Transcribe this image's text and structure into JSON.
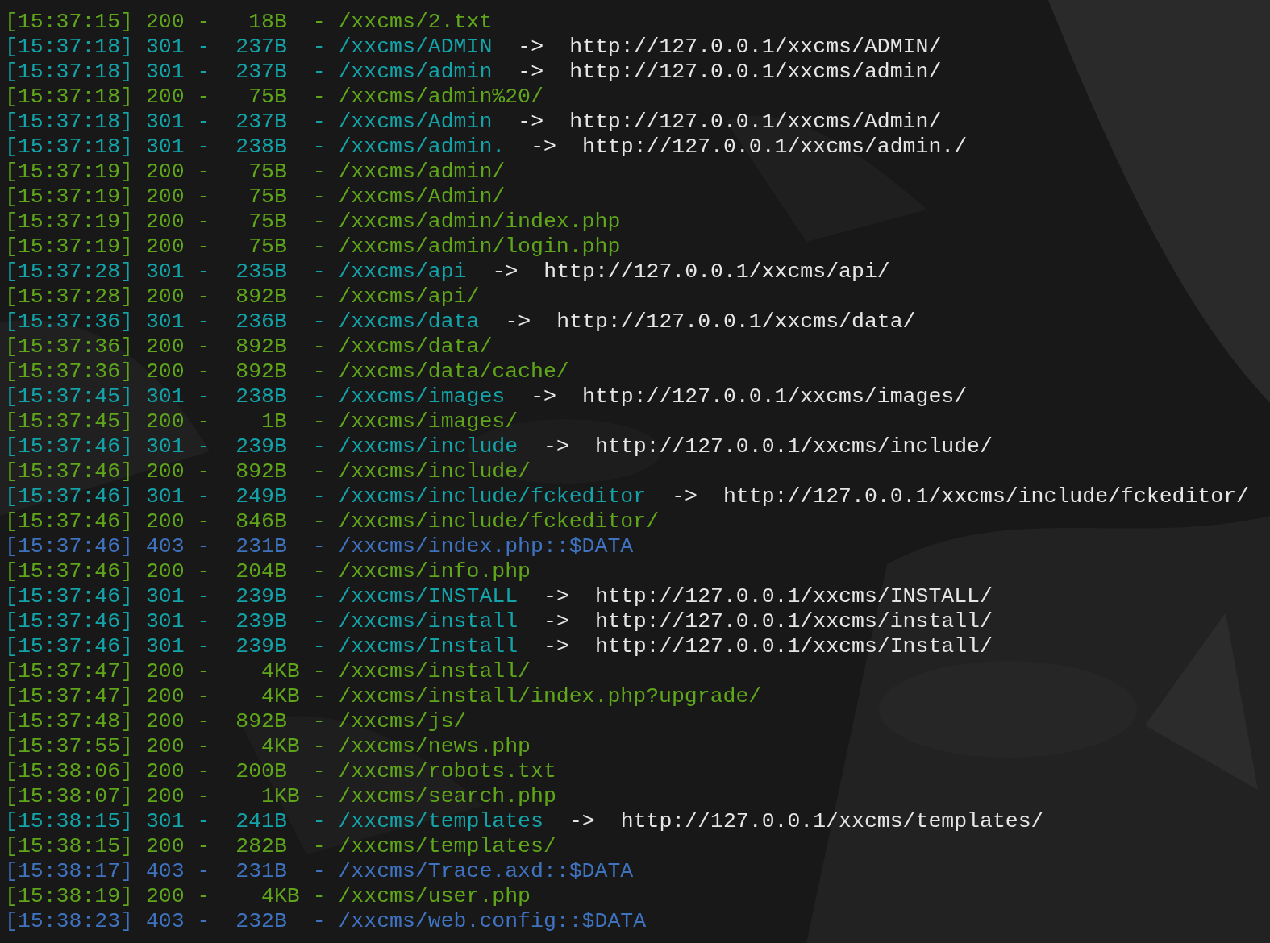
{
  "lines": [
    {
      "kind": "ok",
      "log": "[15:37:15] 200 -   18B  - /xxcms/2.txt"
    },
    {
      "kind": "redirect",
      "log": "[15:37:18] 301 -  237B  - /xxcms/ADMIN",
      "arrow": "->",
      "target": "http://127.0.0.1/xxcms/ADMIN/"
    },
    {
      "kind": "redirect",
      "log": "[15:37:18] 301 -  237B  - /xxcms/admin",
      "arrow": "->",
      "target": "http://127.0.0.1/xxcms/admin/"
    },
    {
      "kind": "ok",
      "log": "[15:37:18] 200 -   75B  - /xxcms/admin%20/"
    },
    {
      "kind": "redirect",
      "log": "[15:37:18] 301 -  237B  - /xxcms/Admin",
      "arrow": "->",
      "target": "http://127.0.0.1/xxcms/Admin/"
    },
    {
      "kind": "redirect",
      "log": "[15:37:18] 301 -  238B  - /xxcms/admin.",
      "arrow": "->",
      "target": "http://127.0.0.1/xxcms/admin./"
    },
    {
      "kind": "ok",
      "log": "[15:37:19] 200 -   75B  - /xxcms/admin/"
    },
    {
      "kind": "ok",
      "log": "[15:37:19] 200 -   75B  - /xxcms/Admin/"
    },
    {
      "kind": "ok",
      "log": "[15:37:19] 200 -   75B  - /xxcms/admin/index.php"
    },
    {
      "kind": "ok",
      "log": "[15:37:19] 200 -   75B  - /xxcms/admin/login.php"
    },
    {
      "kind": "redirect",
      "log": "[15:37:28] 301 -  235B  - /xxcms/api",
      "arrow": "->",
      "target": "http://127.0.0.1/xxcms/api/"
    },
    {
      "kind": "ok",
      "log": "[15:37:28] 200 -  892B  - /xxcms/api/"
    },
    {
      "kind": "redirect",
      "log": "[15:37:36] 301 -  236B  - /xxcms/data",
      "arrow": "->",
      "target": "http://127.0.0.1/xxcms/data/"
    },
    {
      "kind": "ok",
      "log": "[15:37:36] 200 -  892B  - /xxcms/data/"
    },
    {
      "kind": "ok",
      "log": "[15:37:36] 200 -  892B  - /xxcms/data/cache/"
    },
    {
      "kind": "redirect",
      "log": "[15:37:45] 301 -  238B  - /xxcms/images",
      "arrow": "->",
      "target": "http://127.0.0.1/xxcms/images/"
    },
    {
      "kind": "ok",
      "log": "[15:37:45] 200 -    1B  - /xxcms/images/"
    },
    {
      "kind": "redirect",
      "log": "[15:37:46] 301 -  239B  - /xxcms/include",
      "arrow": "->",
      "target": "http://127.0.0.1/xxcms/include/"
    },
    {
      "kind": "ok",
      "log": "[15:37:46] 200 -  892B  - /xxcms/include/"
    },
    {
      "kind": "redirect",
      "log": "[15:37:46] 301 -  249B  - /xxcms/include/fckeditor",
      "arrow": "->",
      "target": "http://127.0.0.1/xxcms/include/fckeditor/"
    },
    {
      "kind": "ok",
      "log": "[15:37:46] 200 -  846B  - /xxcms/include/fckeditor/"
    },
    {
      "kind": "forbidden",
      "log": "[15:37:46] 403 -  231B  - /xxcms/index.php::$DATA"
    },
    {
      "kind": "ok",
      "log": "[15:37:46] 200 -  204B  - /xxcms/info.php"
    },
    {
      "kind": "redirect",
      "log": "[15:37:46] 301 -  239B  - /xxcms/INSTALL",
      "arrow": "->",
      "target": "http://127.0.0.1/xxcms/INSTALL/"
    },
    {
      "kind": "redirect",
      "log": "[15:37:46] 301 -  239B  - /xxcms/install",
      "arrow": "->",
      "target": "http://127.0.0.1/xxcms/install/"
    },
    {
      "kind": "redirect",
      "log": "[15:37:46] 301 -  239B  - /xxcms/Install",
      "arrow": "->",
      "target": "http://127.0.0.1/xxcms/Install/"
    },
    {
      "kind": "ok",
      "log": "[15:37:47] 200 -    4KB - /xxcms/install/"
    },
    {
      "kind": "ok",
      "log": "[15:37:47] 200 -    4KB - /xxcms/install/index.php?upgrade/"
    },
    {
      "kind": "ok",
      "log": "[15:37:48] 200 -  892B  - /xxcms/js/"
    },
    {
      "kind": "ok",
      "log": "[15:37:55] 200 -    4KB - /xxcms/news.php"
    },
    {
      "kind": "ok",
      "log": "[15:38:06] 200 -  200B  - /xxcms/robots.txt"
    },
    {
      "kind": "ok",
      "log": "[15:38:07] 200 -    1KB - /xxcms/search.php"
    },
    {
      "kind": "redirect",
      "log": "[15:38:15] 301 -  241B  - /xxcms/templates",
      "arrow": "->",
      "target": "http://127.0.0.1/xxcms/templates/"
    },
    {
      "kind": "ok",
      "log": "[15:38:15] 200 -  282B  - /xxcms/templates/"
    },
    {
      "kind": "forbidden",
      "log": "[15:38:17] 403 -  231B  - /xxcms/Trace.axd::$DATA"
    },
    {
      "kind": "ok",
      "log": "[15:38:19] 200 -    4KB - /xxcms/user.php"
    },
    {
      "kind": "forbidden",
      "log": "[15:38:23] 403 -  232B  - /xxcms/web.config::$DATA"
    }
  ]
}
